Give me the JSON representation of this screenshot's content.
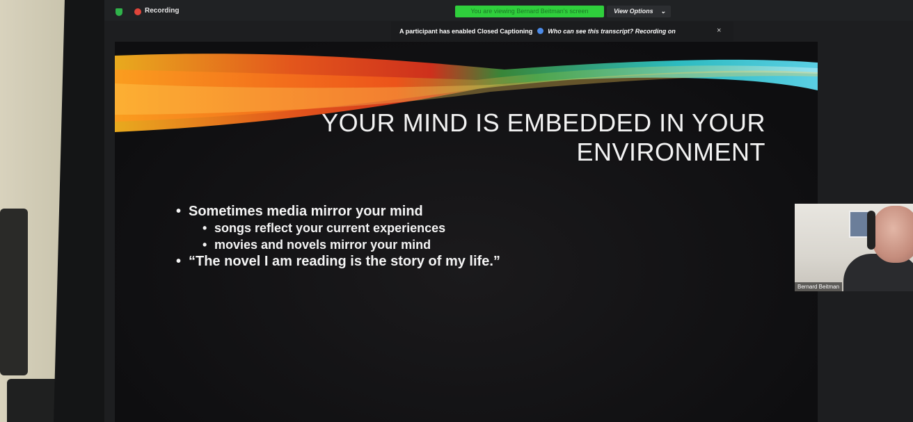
{
  "zoom_bar": {
    "recording_label": "Recording",
    "viewing_banner": "You are viewing Bernard Beitman's screen",
    "view_options_label": "View Options",
    "view_options_chevron": "⌄",
    "caption_notice_prefix": "A participant has enabled Closed Captioning",
    "caption_notice_question": "Who can see this transcript? Recording on",
    "close_glyph": "×"
  },
  "slide": {
    "title_line1": "YOUR MIND IS EMBEDDED IN YOUR",
    "title_line2": "ENVIRONMENT",
    "bullets": [
      "Sometimes media mirror your mind",
      "songs reflect your current experiences",
      "movies and novels mirror your mind",
      "“The novel I am reading is the story of my life.”"
    ]
  },
  "video": {
    "participant_name": "Bernard Beitman"
  },
  "colors": {
    "recording": "#e0453a",
    "viewing_banner_bg": "#2fcf3c",
    "slide_bg": "#0e0e10"
  }
}
